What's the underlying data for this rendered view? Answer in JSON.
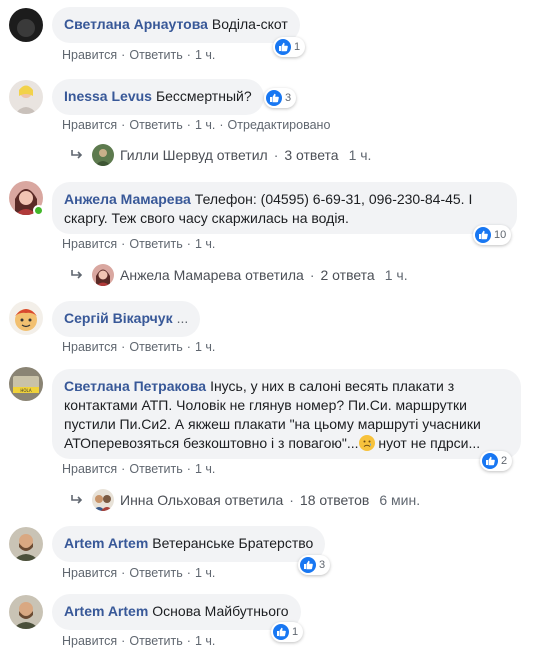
{
  "labels": {
    "like": "Нравится",
    "reply": "Ответить",
    "edited": "Отредактировано",
    "sep": "·"
  },
  "comments": [
    {
      "author": "Светлана Арнаутова",
      "text": "Воділа-скот",
      "reactions": "1",
      "time": "1 ч."
    },
    {
      "author": "Inessa Levus",
      "text": "Бессмертный?",
      "reactions": "3",
      "time": "1 ч.",
      "reply_summary": {
        "name": "Гилли Шервуд ответил",
        "count": "3 ответа",
        "time": "1 ч."
      }
    },
    {
      "author": "Анжела Мамарева",
      "text_line1": "Телефон: (04595) 6-69-31, 096-230-84-45. І",
      "text_line2": "скаргу. Теж свого часу скаржилась на водія.",
      "reactions": "10",
      "time": "1 ч.",
      "reply_summary": {
        "name": "Анжела Мамарева ответила",
        "count": "2 ответа",
        "time": "1 ч."
      }
    },
    {
      "author": "Сергій Вікарчук",
      "text": "...",
      "time": "1 ч."
    },
    {
      "author": "Светлана Петракова",
      "text_line1": "Інусь, у них в салоні весять плакати з",
      "text_line2": "контактами АТП. Чоловік не глянув номер? Пи.Си. маршрутки",
      "text_line3": "пустили Пи.Си2. А якжеш плакати \"на цьому маршруті учасники",
      "text_line4": "АТОперевозяться безкоштовно і з повагою\"...",
      "text_line4b": " нуот не пдрси...",
      "reactions": "2",
      "time": "1 ч.",
      "reply_summary": {
        "name": "Инна Ольховая ответила",
        "count": "18 ответов",
        "time": "6 мин."
      }
    },
    {
      "author": "Artem Artem",
      "text": "Ветеранське Братерство",
      "reactions": "3",
      "time": "1 ч."
    },
    {
      "author": "Artem Artem",
      "text": "Основа Майбутнього",
      "reactions": "1",
      "time": "1 ч."
    }
  ],
  "colors": {
    "link": "#385898",
    "bubble": "#f2f3f5",
    "like": "#1877f2",
    "meta": "#606770"
  }
}
